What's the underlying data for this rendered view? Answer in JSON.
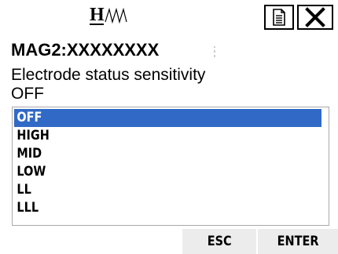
{
  "header": {
    "logo_text": "H",
    "logo_icon": "waveform-logo",
    "doc_button_icon": "document-icon",
    "close_button_icon": "close-icon"
  },
  "device": {
    "name": "MAG2:XXXXXXXX"
  },
  "setting": {
    "title": "Electrode status sensitivity",
    "current_value": "OFF"
  },
  "options": {
    "selected_index": 0,
    "items": [
      {
        "label": "OFF"
      },
      {
        "label": "HIGH"
      },
      {
        "label": "MID"
      },
      {
        "label": "LOW"
      },
      {
        "label": "LL"
      },
      {
        "label": "LLL"
      }
    ]
  },
  "buttons": {
    "esc_label": "ESC",
    "enter_label": "ENTER"
  },
  "colors": {
    "selection": "#3169c6",
    "button_bg": "#ececec"
  }
}
